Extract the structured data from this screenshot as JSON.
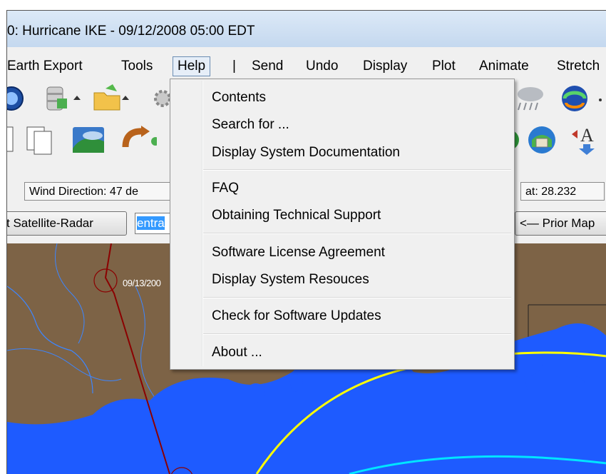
{
  "window": {
    "title": "0: Hurricane IKE - 09/12/2008 05:00 EDT"
  },
  "menubar": {
    "items": [
      {
        "label": "Earth Export"
      },
      {
        "label": "Tools"
      },
      {
        "label": "Help"
      },
      {
        "label": "|"
      },
      {
        "label": "Send"
      },
      {
        "label": "Undo"
      },
      {
        "label": "Display"
      },
      {
        "label": "Plot"
      },
      {
        "label": "Animate"
      },
      {
        "label": "Stretch"
      }
    ]
  },
  "toolbar_icons": {
    "row1": [
      "globe-search-icon",
      "database-export-icon",
      "open-folder-icon",
      "gear-icon",
      "rain-cloud-icon",
      "globe-refresh-icon"
    ],
    "row2": [
      "copy-icon",
      "copy-pages-icon",
      "google-earth-icon",
      "undo-arrow-icon",
      "globe-green-icon",
      "globe-building-icon",
      "font-arrow-icon"
    ]
  },
  "status": {
    "wind_direction": "Wind Direction: 47 de",
    "lat": "at: 28.232"
  },
  "buttons": {
    "satellite_radar": "t Satellite-Radar",
    "combo_value": "entra",
    "prior_map": "<— Prior Map"
  },
  "map": {
    "track_label": "09/13/200",
    "colors": {
      "land": "#7d6346",
      "water": "#1e5bff",
      "track": "#8b0000",
      "ring_yellow": "#ffff00",
      "ring_cyan": "#00e5ff"
    }
  },
  "help_menu": {
    "items": [
      "Contents",
      "Search for ...",
      "Display System Documentation",
      "FAQ",
      "Obtaining Technical Support",
      "Software License Agreement",
      "Display System Resouces",
      "Check for Software Updates",
      "About ..."
    ]
  }
}
